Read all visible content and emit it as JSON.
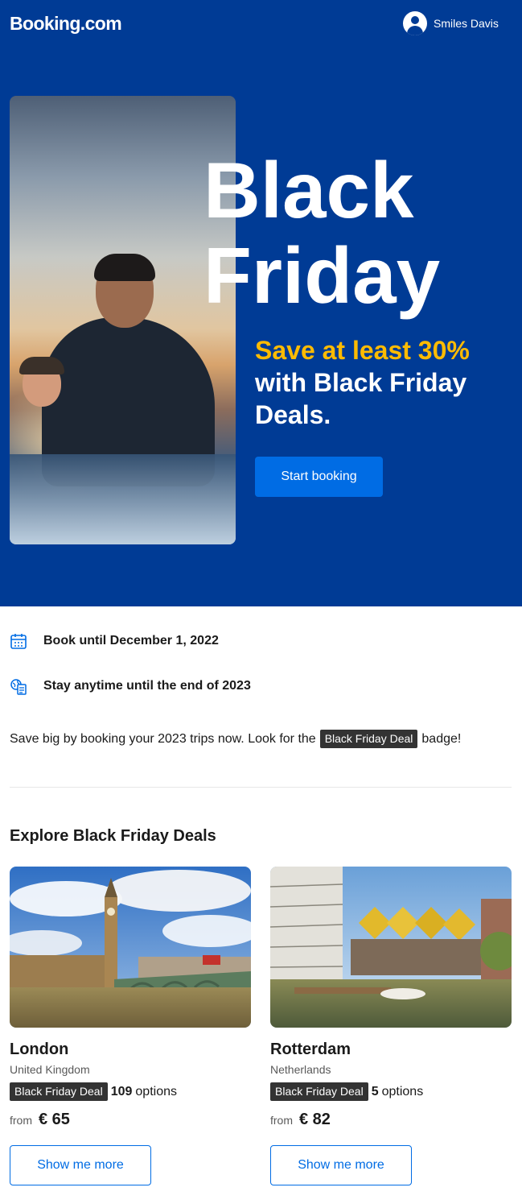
{
  "header": {
    "logo": "Booking.com",
    "user_name": "Smiles Davis"
  },
  "hero": {
    "title_line1": "Black",
    "title_line2": "Friday",
    "highlight": "Save at least 30%",
    "subtitle": "with Black Friday Deals.",
    "cta_label": "Start booking"
  },
  "info": {
    "book_until": "Book until December 1, 2022",
    "stay_until": "Stay anytime until the end of 2023",
    "save_text_before": "Save big by booking your 2023 trips now. Look for the",
    "badge": "Black Friday Deal",
    "save_text_after": "badge!"
  },
  "section": {
    "title": "Explore Black Friday Deals"
  },
  "deals": [
    {
      "city": "London",
      "country": "United Kingdom",
      "badge": "Black Friday Deal",
      "count": "109",
      "options_label": "options",
      "from_label": "from",
      "price": "€ 65",
      "button": "Show me more"
    },
    {
      "city": "Rotterdam",
      "country": "Netherlands",
      "badge": "Black Friday Deal",
      "count": "5",
      "options_label": "options",
      "from_label": "from",
      "price": "€ 82",
      "button": "Show me more"
    }
  ],
  "colors": {
    "brand_blue": "#003b95",
    "accent_yellow": "#febb02",
    "button_blue": "#006ce4",
    "badge_dark": "#333333"
  }
}
